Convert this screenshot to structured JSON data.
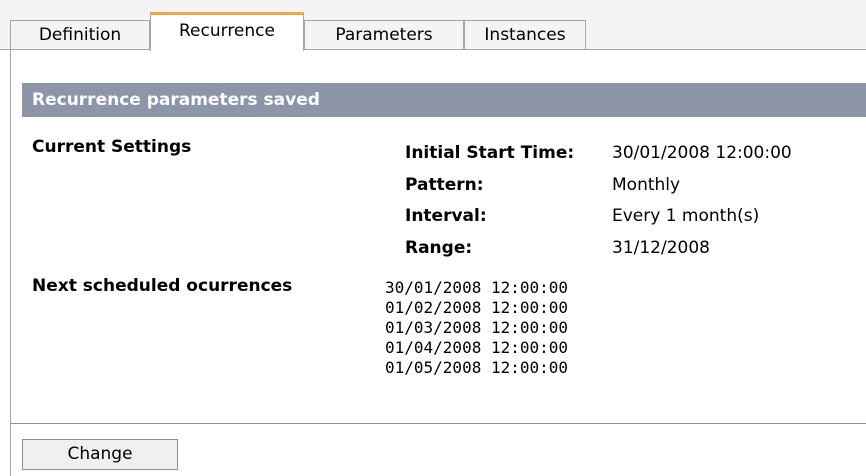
{
  "tabs": [
    {
      "label": "Definition",
      "active": false
    },
    {
      "label": "Recurrence",
      "active": true
    },
    {
      "label": "Parameters",
      "active": false
    },
    {
      "label": "Instances",
      "active": false
    }
  ],
  "banner": {
    "text": "Recurrence parameters saved",
    "background": "#8d96a8"
  },
  "current_settings": {
    "heading": "Current Settings",
    "fields": [
      {
        "label": "Initial Start Time:",
        "value": "30/01/2008 12:00:00"
      },
      {
        "label": "Pattern:",
        "value": "Monthly"
      },
      {
        "label": "Interval:",
        "value": "Every 1 month(s)"
      },
      {
        "label": "Range:",
        "value": "31/12/2008"
      }
    ]
  },
  "next_occurrences": {
    "heading": "Next scheduled ocurrences",
    "dates": [
      "30/01/2008 12:00:00",
      "01/02/2008 12:00:00",
      "01/03/2008 12:00:00",
      "01/04/2008 12:00:00",
      "01/05/2008 12:00:00"
    ]
  },
  "actions": {
    "change_label": "Change"
  },
  "colors": {
    "active_tab_accent": "#f3a93a",
    "divider": "#7b96c6"
  }
}
